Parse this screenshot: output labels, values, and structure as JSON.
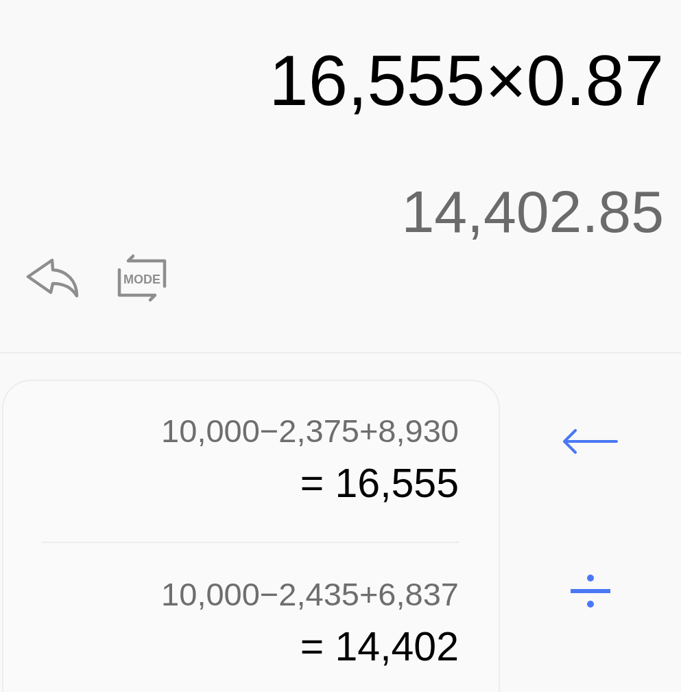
{
  "display": {
    "expression": "16,555×0.87",
    "result": "14,402.85"
  },
  "toolbar": [
    {
      "kind": "undo"
    },
    {
      "kind": "mode",
      "label": "MODE"
    }
  ],
  "history": [
    {
      "expression": "10,000−2,375+8,930",
      "result": "= 16,555"
    },
    {
      "expression": "10,000−2,435+6,837",
      "result": "= 14,402"
    }
  ],
  "side_keys": [
    {
      "kind": "arrow"
    },
    {
      "kind": "divide"
    }
  ]
}
